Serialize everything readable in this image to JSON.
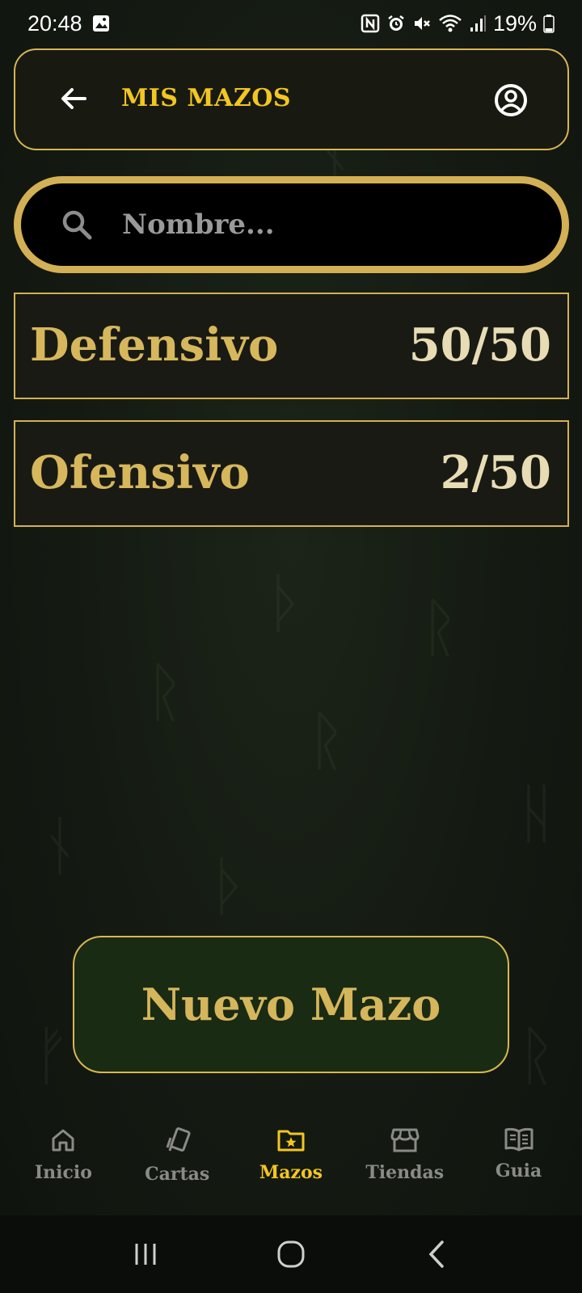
{
  "status_bar": {
    "time": "20:48",
    "battery": "19%",
    "icons": [
      "image-icon",
      "nfc-icon",
      "alarm-icon",
      "mute-icon",
      "wifi-icon",
      "signal-icon",
      "battery-icon"
    ]
  },
  "header": {
    "title": "MIS MAZOS",
    "back_icon": "arrow-left-icon",
    "profile_icon": "user-circle-icon"
  },
  "search": {
    "placeholder": "Nombre...",
    "value": ""
  },
  "decks": [
    {
      "name": "Defensivo",
      "count": "50/50"
    },
    {
      "name": "Ofensivo",
      "count": "2/50"
    }
  ],
  "new_deck_button": {
    "label": "Nuevo Mazo"
  },
  "bottom_nav": {
    "items": [
      {
        "label": "Inicio",
        "icon": "home-icon"
      },
      {
        "label": "Cartas",
        "icon": "cards-icon"
      },
      {
        "label": "Mazos",
        "icon": "folder-star-icon",
        "active": true
      },
      {
        "label": "Tiendas",
        "icon": "store-icon"
      },
      {
        "label": "Guia",
        "icon": "book-icon"
      }
    ]
  },
  "system_nav": [
    "recents-icon",
    "home-circle-icon",
    "back-chevron-icon"
  ],
  "colors": {
    "accent": "#f3c621",
    "gold": "#d4b55a",
    "background": "#141a12",
    "inactive": "#8a8a86"
  }
}
